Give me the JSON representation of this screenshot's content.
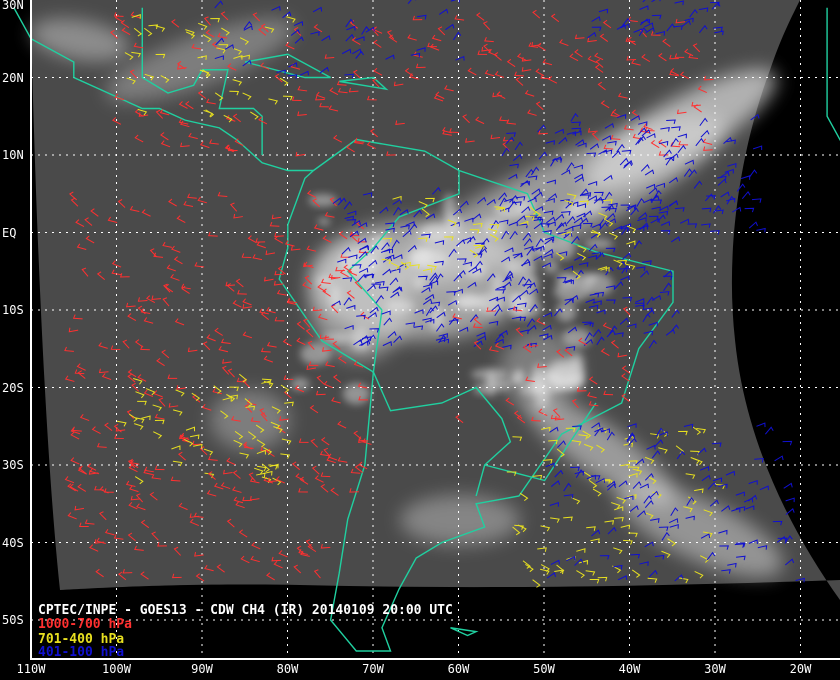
{
  "title": "CPTEC/INPE - GOES13 - CDW CH4 (IR) 20140109 20:00 UTC",
  "legend": [
    {
      "label": "1000-700 hPa",
      "color": "#ff3030"
    },
    {
      "label": "701-400 hPa",
      "color": "#e8e020"
    },
    {
      "label": "401-100 hPa",
      "color": "#1010d0"
    }
  ],
  "lon_labels": [
    "110W",
    "100W",
    "90W",
    "80W",
    "70W",
    "60W",
    "50W",
    "40W",
    "30W",
    "20W"
  ],
  "lat_labels": [
    "30N",
    "20N",
    "10N",
    "EQ",
    "10S",
    "20S",
    "30S",
    "40S",
    "50S"
  ],
  "coast_color": "#20d0a0"
}
